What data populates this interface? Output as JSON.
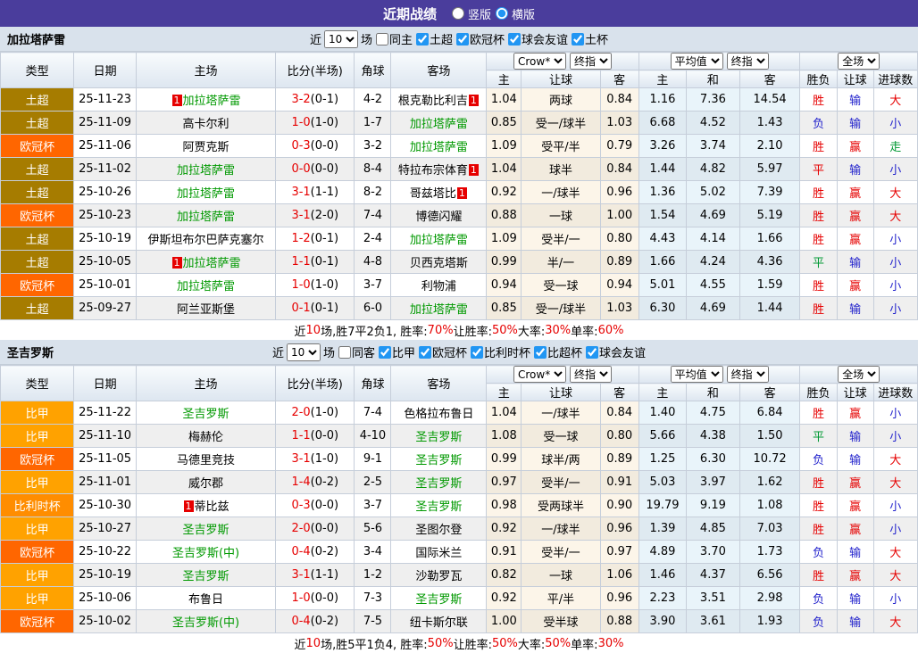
{
  "titlebar": {
    "title": "近期战绩",
    "radios": [
      {
        "label": "竖版",
        "checked": false
      },
      {
        "label": "横版",
        "checked": true
      }
    ]
  },
  "colors": {
    "titlebar_bg": "#4a3d9c",
    "band_bg": "#d9e2ec",
    "win_red": "#e60000",
    "draw_green": "#009933",
    "lose_blue": "#2222cc",
    "team_green": "#009900",
    "checkbox_accent": "#2196f3"
  },
  "league_colors": {
    "土超": "#a67c00",
    "欧冠杯": "#ff6600",
    "比甲": "#ffa200",
    "比利时杯": "#ff8d00"
  },
  "columns_left": [
    "类型",
    "日期",
    "主场",
    "比分(半场)",
    "角球",
    "客场"
  ],
  "columns_sub": [
    "主",
    "让球",
    "客",
    "主",
    "和",
    "客",
    "胜负",
    "让球",
    "进球数"
  ],
  "dropdown_groups": [
    [
      "Crow*",
      "终指"
    ],
    [
      "平均值",
      "终指"
    ],
    [
      "全场"
    ]
  ],
  "sections": [
    {
      "team": "加拉塔萨雷",
      "filter": {
        "near": "近",
        "count": "10",
        "games": "场",
        "same": {
          "label": "同主",
          "checked": false
        },
        "leagues": [
          {
            "label": "土超",
            "checked": true
          },
          {
            "label": "欧冠杯",
            "checked": true
          },
          {
            "label": "球会友谊",
            "checked": true
          },
          {
            "label": "土杯",
            "checked": true
          }
        ]
      },
      "rows": [
        {
          "league": "土超",
          "date": "25-11-23",
          "home": {
            "name": "加拉塔萨雷",
            "green": true,
            "badge_pre": "1"
          },
          "score": "3-2",
          "half": "(0-1)",
          "corner": "4-2",
          "away": {
            "name": "根克勒比利吉",
            "badge_post": "1"
          },
          "odds": [
            "1.04",
            "两球",
            "0.84"
          ],
          "avg": [
            "1.16",
            "7.36",
            "14.54"
          ],
          "res": [
            [
              "胜",
              "r"
            ],
            [
              "输",
              "b"
            ],
            [
              "大",
              "r"
            ]
          ]
        },
        {
          "league": "土超",
          "date": "25-11-09",
          "home": {
            "name": "高卡尔利"
          },
          "score": "1-0",
          "half": "(1-0)",
          "corner": "1-7",
          "away": {
            "name": "加拉塔萨雷",
            "green": true
          },
          "odds": [
            "0.85",
            "受一/球半",
            "1.03"
          ],
          "avg": [
            "6.68",
            "4.52",
            "1.43"
          ],
          "res": [
            [
              "负",
              "b"
            ],
            [
              "输",
              "b"
            ],
            [
              "小",
              "b"
            ]
          ]
        },
        {
          "league": "欧冠杯",
          "date": "25-11-06",
          "home": {
            "name": "阿贾克斯"
          },
          "score": "0-3",
          "half": "(0-0)",
          "corner": "3-2",
          "away": {
            "name": "加拉塔萨雷",
            "green": true
          },
          "odds": [
            "1.09",
            "受平/半",
            "0.79"
          ],
          "avg": [
            "3.26",
            "3.74",
            "2.10"
          ],
          "res": [
            [
              "胜",
              "r"
            ],
            [
              "赢",
              "r"
            ],
            [
              "走",
              "g"
            ]
          ]
        },
        {
          "league": "土超",
          "date": "25-11-02",
          "home": {
            "name": "加拉塔萨雷",
            "green": true
          },
          "score": "0-0",
          "half": "(0-0)",
          "corner": "8-4",
          "away": {
            "name": "特拉布宗体育",
            "badge_post": "1"
          },
          "odds": [
            "1.04",
            "球半",
            "0.84"
          ],
          "avg": [
            "1.44",
            "4.82",
            "5.97"
          ],
          "res": [
            [
              "平",
              "r"
            ],
            [
              "输",
              "b"
            ],
            [
              "小",
              "b"
            ]
          ]
        },
        {
          "league": "土超",
          "date": "25-10-26",
          "home": {
            "name": "加拉塔萨雷",
            "green": true
          },
          "score": "3-1",
          "half": "(1-1)",
          "corner": "8-2",
          "away": {
            "name": "哥兹塔比",
            "badge_post": "1"
          },
          "odds": [
            "0.92",
            "一/球半",
            "0.96"
          ],
          "avg": [
            "1.36",
            "5.02",
            "7.39"
          ],
          "res": [
            [
              "胜",
              "r"
            ],
            [
              "赢",
              "r"
            ],
            [
              "大",
              "r"
            ]
          ]
        },
        {
          "league": "欧冠杯",
          "date": "25-10-23",
          "home": {
            "name": "加拉塔萨雷",
            "green": true
          },
          "score": "3-1",
          "half": "(2-0)",
          "corner": "7-4",
          "away": {
            "name": "博德闪耀"
          },
          "odds": [
            "0.88",
            "一球",
            "1.00"
          ],
          "avg": [
            "1.54",
            "4.69",
            "5.19"
          ],
          "res": [
            [
              "胜",
              "r"
            ],
            [
              "赢",
              "r"
            ],
            [
              "大",
              "r"
            ]
          ]
        },
        {
          "league": "土超",
          "date": "25-10-19",
          "home": {
            "name": "伊斯坦布尔巴萨克塞尔"
          },
          "score": "1-2",
          "half": "(0-1)",
          "corner": "2-4",
          "away": {
            "name": "加拉塔萨雷",
            "green": true
          },
          "odds": [
            "1.09",
            "受半/一",
            "0.80"
          ],
          "avg": [
            "4.43",
            "4.14",
            "1.66"
          ],
          "res": [
            [
              "胜",
              "r"
            ],
            [
              "赢",
              "r"
            ],
            [
              "小",
              "b"
            ]
          ]
        },
        {
          "league": "土超",
          "date": "25-10-05",
          "home": {
            "name": "加拉塔萨雷",
            "green": true,
            "badge_pre": "1"
          },
          "score": "1-1",
          "half": "(0-1)",
          "corner": "4-8",
          "away": {
            "name": "贝西克塔斯"
          },
          "odds": [
            "0.99",
            "半/一",
            "0.89"
          ],
          "avg": [
            "1.66",
            "4.24",
            "4.36"
          ],
          "res": [
            [
              "平",
              "g"
            ],
            [
              "输",
              "b"
            ],
            [
              "小",
              "b"
            ]
          ]
        },
        {
          "league": "欧冠杯",
          "date": "25-10-01",
          "home": {
            "name": "加拉塔萨雷",
            "green": true
          },
          "score": "1-0",
          "half": "(1-0)",
          "corner": "3-7",
          "away": {
            "name": "利物浦"
          },
          "odds": [
            "0.94",
            "受一球",
            "0.94"
          ],
          "avg": [
            "5.01",
            "4.55",
            "1.59"
          ],
          "res": [
            [
              "胜",
              "r"
            ],
            [
              "赢",
              "r"
            ],
            [
              "小",
              "b"
            ]
          ]
        },
        {
          "league": "土超",
          "date": "25-09-27",
          "home": {
            "name": "阿兰亚斯堡"
          },
          "score": "0-1",
          "half": "(0-1)",
          "corner": "6-0",
          "away": {
            "name": "加拉塔萨雷",
            "green": true
          },
          "odds": [
            "0.85",
            "受一/球半",
            "1.03"
          ],
          "avg": [
            "6.30",
            "4.69",
            "1.44"
          ],
          "res": [
            [
              "胜",
              "r"
            ],
            [
              "输",
              "b"
            ],
            [
              "小",
              "b"
            ]
          ]
        }
      ],
      "summary": [
        [
          "近",
          "k"
        ],
        [
          "10",
          "r"
        ],
        [
          "场,胜7平2负1, 胜率:",
          "k"
        ],
        [
          "70%",
          "r"
        ],
        [
          " 让胜率:",
          "k"
        ],
        [
          "50%",
          "r"
        ],
        [
          " 大率:",
          "k"
        ],
        [
          "30%",
          "r"
        ],
        [
          " 单率:",
          "k"
        ],
        [
          "60%",
          "r"
        ]
      ]
    },
    {
      "team": "圣吉罗斯",
      "filter": {
        "near": "近",
        "count": "10",
        "games": "场",
        "same": {
          "label": "同客",
          "checked": false
        },
        "leagues": [
          {
            "label": "比甲",
            "checked": true
          },
          {
            "label": "欧冠杯",
            "checked": true
          },
          {
            "label": "比利时杯",
            "checked": true
          },
          {
            "label": "比超杯",
            "checked": true
          },
          {
            "label": "球会友谊",
            "checked": true
          }
        ]
      },
      "rows": [
        {
          "league": "比甲",
          "date": "25-11-22",
          "home": {
            "name": "圣吉罗斯",
            "green": true
          },
          "score": "2-0",
          "half": "(1-0)",
          "corner": "7-4",
          "away": {
            "name": "色格拉布鲁日"
          },
          "odds": [
            "1.04",
            "一/球半",
            "0.84"
          ],
          "avg": [
            "1.40",
            "4.75",
            "6.84"
          ],
          "res": [
            [
              "胜",
              "r"
            ],
            [
              "赢",
              "r"
            ],
            [
              "小",
              "b"
            ]
          ]
        },
        {
          "league": "比甲",
          "date": "25-11-10",
          "home": {
            "name": "梅赫伦"
          },
          "score": "1-1",
          "half": "(0-0)",
          "corner": "4-10",
          "away": {
            "name": "圣吉罗斯",
            "green": true
          },
          "odds": [
            "1.08",
            "受一球",
            "0.80"
          ],
          "avg": [
            "5.66",
            "4.38",
            "1.50"
          ],
          "res": [
            [
              "平",
              "g"
            ],
            [
              "输",
              "b"
            ],
            [
              "小",
              "b"
            ]
          ]
        },
        {
          "league": "欧冠杯",
          "date": "25-11-05",
          "home": {
            "name": "马德里竞技"
          },
          "score": "3-1",
          "half": "(1-0)",
          "corner": "9-1",
          "away": {
            "name": "圣吉罗斯",
            "green": true
          },
          "odds": [
            "0.99",
            "球半/两",
            "0.89"
          ],
          "avg": [
            "1.25",
            "6.30",
            "10.72"
          ],
          "res": [
            [
              "负",
              "b"
            ],
            [
              "输",
              "b"
            ],
            [
              "大",
              "r"
            ]
          ]
        },
        {
          "league": "比甲",
          "date": "25-11-01",
          "home": {
            "name": "威尔郡"
          },
          "score": "1-4",
          "half": "(0-2)",
          "corner": "2-5",
          "away": {
            "name": "圣吉罗斯",
            "green": true
          },
          "odds": [
            "0.97",
            "受半/一",
            "0.91"
          ],
          "avg": [
            "5.03",
            "3.97",
            "1.62"
          ],
          "res": [
            [
              "胜",
              "r"
            ],
            [
              "赢",
              "r"
            ],
            [
              "大",
              "r"
            ]
          ]
        },
        {
          "league": "比利时杯",
          "date": "25-10-30",
          "home": {
            "name": "蒂比兹",
            "badge_pre": "1"
          },
          "score": "0-3",
          "half": "(0-0)",
          "corner": "3-7",
          "away": {
            "name": "圣吉罗斯",
            "green": true
          },
          "odds": [
            "0.98",
            "受两球半",
            "0.90"
          ],
          "avg": [
            "19.79",
            "9.19",
            "1.08"
          ],
          "res": [
            [
              "胜",
              "r"
            ],
            [
              "赢",
              "r"
            ],
            [
              "小",
              "b"
            ]
          ]
        },
        {
          "league": "比甲",
          "date": "25-10-27",
          "home": {
            "name": "圣吉罗斯",
            "green": true
          },
          "score": "2-0",
          "half": "(0-0)",
          "corner": "5-6",
          "away": {
            "name": "圣图尔登"
          },
          "odds": [
            "0.92",
            "一/球半",
            "0.96"
          ],
          "avg": [
            "1.39",
            "4.85",
            "7.03"
          ],
          "res": [
            [
              "胜",
              "r"
            ],
            [
              "赢",
              "r"
            ],
            [
              "小",
              "b"
            ]
          ]
        },
        {
          "league": "欧冠杯",
          "date": "25-10-22",
          "home": {
            "name": "圣吉罗斯(中)",
            "green": true
          },
          "score": "0-4",
          "half": "(0-2)",
          "corner": "3-4",
          "away": {
            "name": "国际米兰"
          },
          "odds": [
            "0.91",
            "受半/一",
            "0.97"
          ],
          "avg": [
            "4.89",
            "3.70",
            "1.73"
          ],
          "res": [
            [
              "负",
              "b"
            ],
            [
              "输",
              "b"
            ],
            [
              "大",
              "r"
            ]
          ]
        },
        {
          "league": "比甲",
          "date": "25-10-19",
          "home": {
            "name": "圣吉罗斯",
            "green": true
          },
          "score": "3-1",
          "half": "(1-1)",
          "corner": "1-2",
          "away": {
            "name": "沙勒罗瓦"
          },
          "odds": [
            "0.82",
            "一球",
            "1.06"
          ],
          "avg": [
            "1.46",
            "4.37",
            "6.56"
          ],
          "res": [
            [
              "胜",
              "r"
            ],
            [
              "赢",
              "r"
            ],
            [
              "大",
              "r"
            ]
          ]
        },
        {
          "league": "比甲",
          "date": "25-10-06",
          "home": {
            "name": "布鲁日"
          },
          "score": "1-0",
          "half": "(0-0)",
          "corner": "7-3",
          "away": {
            "name": "圣吉罗斯",
            "green": true
          },
          "odds": [
            "0.92",
            "平/半",
            "0.96"
          ],
          "avg": [
            "2.23",
            "3.51",
            "2.98"
          ],
          "res": [
            [
              "负",
              "b"
            ],
            [
              "输",
              "b"
            ],
            [
              "小",
              "b"
            ]
          ]
        },
        {
          "league": "欧冠杯",
          "date": "25-10-02",
          "home": {
            "name": "圣吉罗斯(中)",
            "green": true
          },
          "score": "0-4",
          "half": "(0-2)",
          "corner": "7-5",
          "away": {
            "name": "纽卡斯尔联"
          },
          "odds": [
            "1.00",
            "受半球",
            "0.88"
          ],
          "avg": [
            "3.90",
            "3.61",
            "1.93"
          ],
          "res": [
            [
              "负",
              "b"
            ],
            [
              "输",
              "b"
            ],
            [
              "大",
              "r"
            ]
          ]
        }
      ],
      "summary": [
        [
          "近",
          "k"
        ],
        [
          "10",
          "r"
        ],
        [
          "场,胜5平1负4, 胜率:",
          "k"
        ],
        [
          "50%",
          "r"
        ],
        [
          " 让胜率:",
          "k"
        ],
        [
          "50%",
          "r"
        ],
        [
          " 大率:",
          "k"
        ],
        [
          "50%",
          "r"
        ],
        [
          " 单率:",
          "k"
        ],
        [
          "30%",
          "r"
        ]
      ]
    }
  ]
}
